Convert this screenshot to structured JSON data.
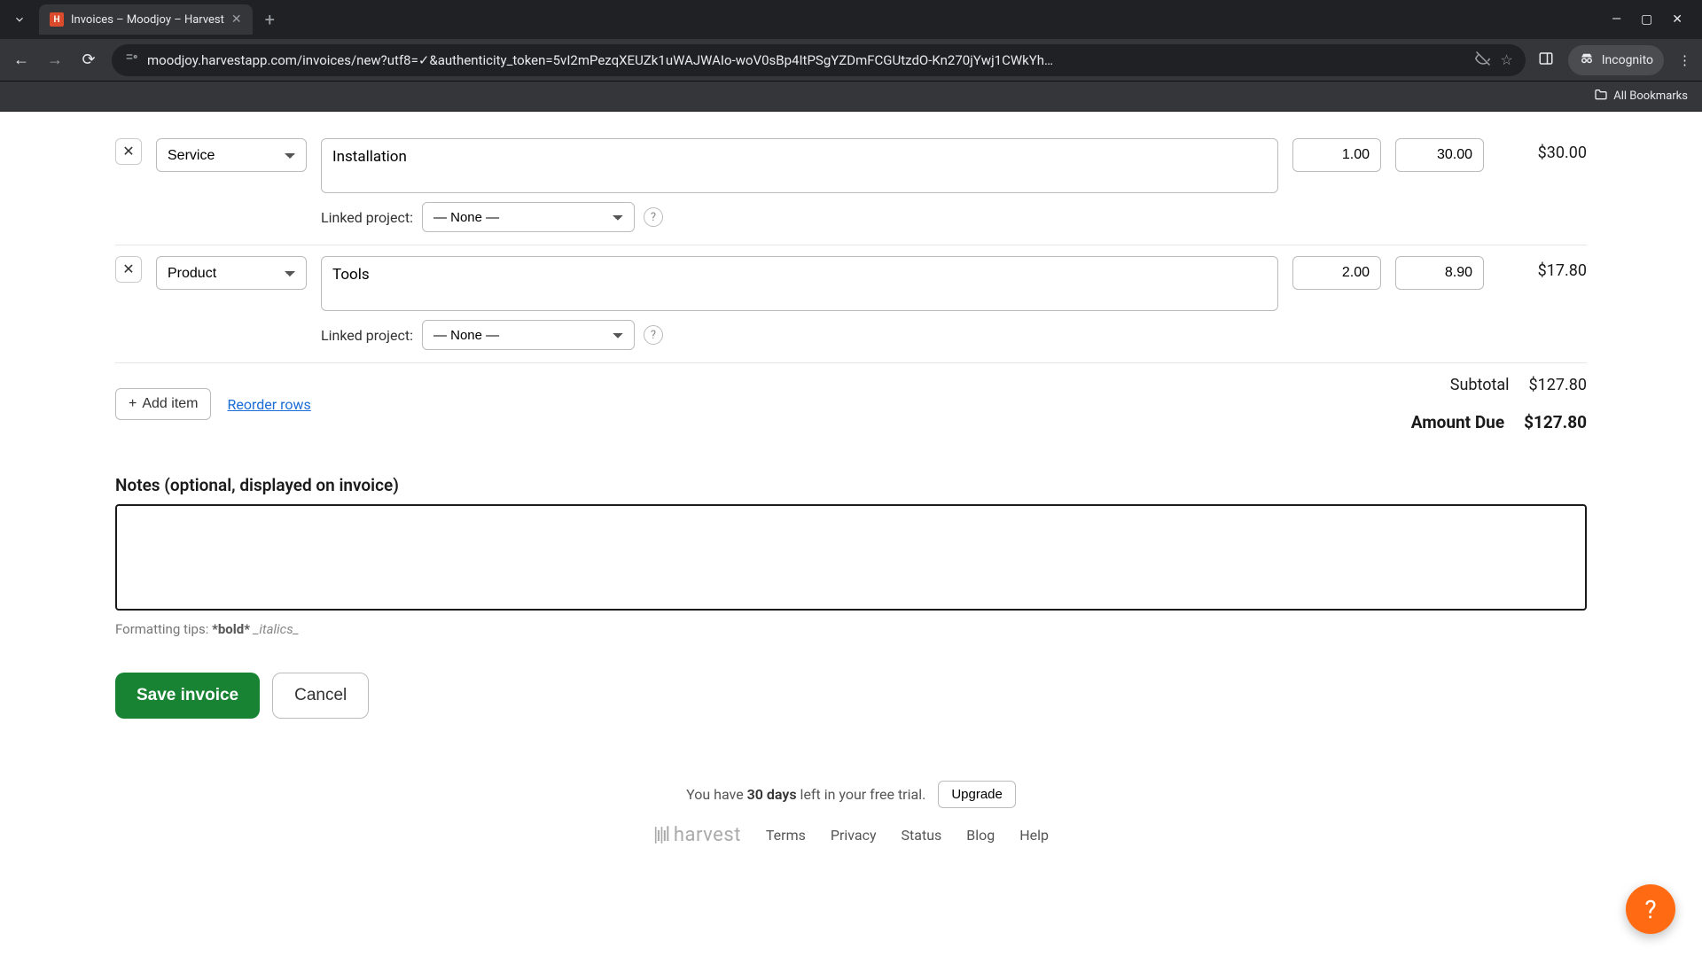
{
  "browser": {
    "tab_title": "Invoices – Moodjoy – Harvest",
    "url_display": "moodjoy.harvestapp.com/invoices/new?utf8=✓&authenticity_token=5vI2mPezqXEUZk1uWAJWAIo-woV0sBp4ItPSgYZDmFCGUtzdO-Kn270jYwj1CWkYh…",
    "incognito_label": "Incognito",
    "all_bookmarks": "All Bookmarks"
  },
  "line_items": [
    {
      "type": "Service",
      "description": "Installation",
      "linked_project_label": "Linked project:",
      "linked_project_value": "— None —",
      "qty": "1.00",
      "unit_price": "30.00",
      "amount": "$30.00"
    },
    {
      "type": "Product",
      "description": "Tools",
      "linked_project_label": "Linked project:",
      "linked_project_value": "— None —",
      "qty": "2.00",
      "unit_price": "8.90",
      "amount": "$17.80"
    }
  ],
  "actions": {
    "add_item": "Add item",
    "reorder": "Reorder rows"
  },
  "totals": {
    "subtotal_label": "Subtotal",
    "subtotal_value": "$127.80",
    "amount_due_label": "Amount Due",
    "amount_due_value": "$127.80"
  },
  "notes": {
    "label": "Notes (optional, displayed on invoice)",
    "value": "",
    "formatting_prefix": "Formatting tips: ",
    "bold_example": "*bold*",
    "italics_example": "_italics_"
  },
  "form": {
    "save": "Save invoice",
    "cancel": "Cancel"
  },
  "footer": {
    "trial_prefix": "You have ",
    "trial_days": "30 days",
    "trial_suffix": " left in your free trial.",
    "upgrade": "Upgrade",
    "brand": "harvest",
    "links": {
      "terms": "Terms",
      "privacy": "Privacy",
      "status": "Status",
      "blog": "Blog",
      "help": "Help"
    }
  }
}
